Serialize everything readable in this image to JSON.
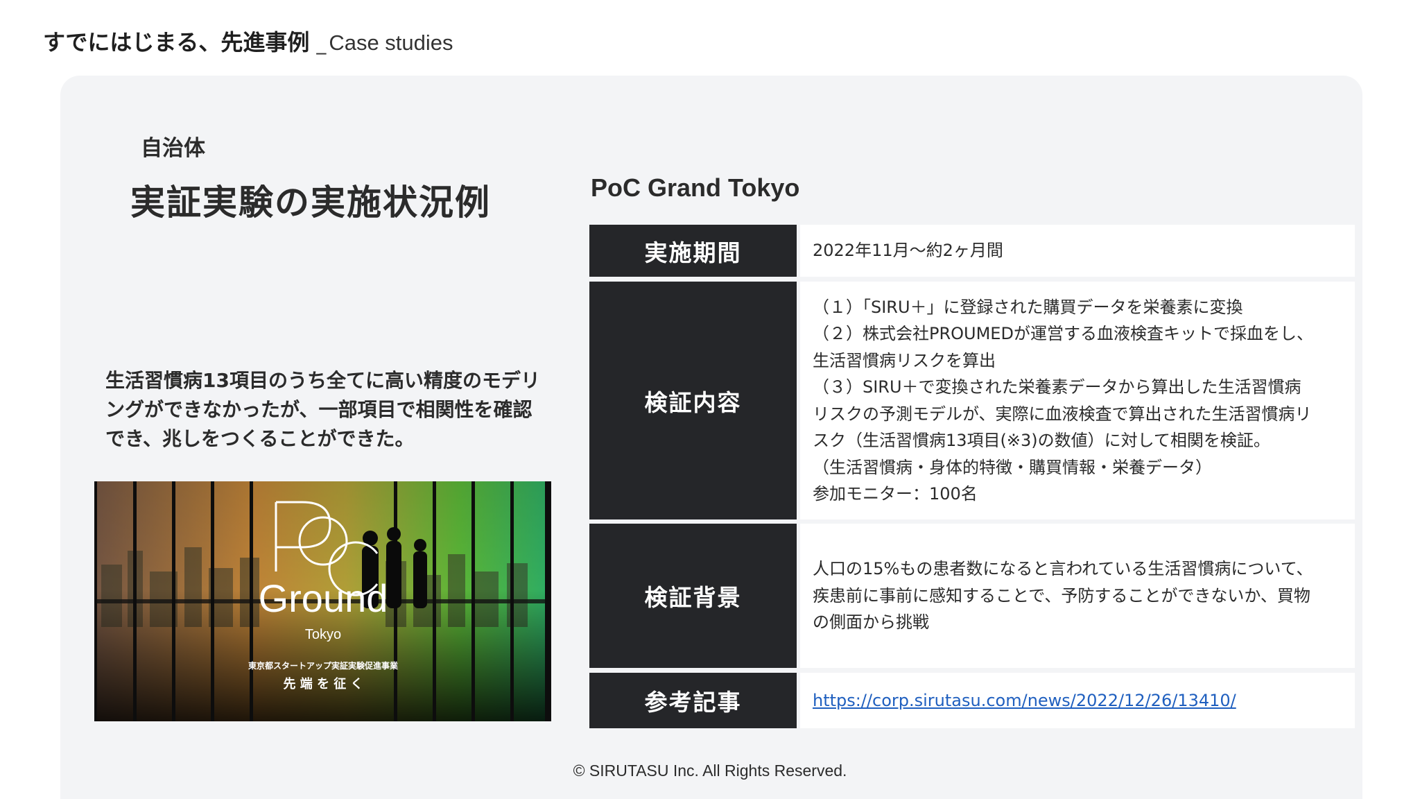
{
  "header": {
    "title": "すでにはじまる、先進事例",
    "separator": "_",
    "subtitle": "Case studies"
  },
  "left": {
    "category": "自治体",
    "title": "実証実験の実施状況例",
    "summary": "生活習慣病13項目のうち全てに高い精度のモデリングができなかったが、一部項目で相関性を確認でき、兆しをつくることができた。",
    "image": {
      "logo_main": "Ground",
      "logo_sub": "Tokyo",
      "caption1": "東京都スタートアップ実証実験促進事業",
      "caption2": "先 端 を 征 く"
    }
  },
  "poc": {
    "title": "PoC Grand Tokyo",
    "rows": [
      {
        "label": "実施期間",
        "lines": [
          "2022年11月〜約2ヶ月間"
        ]
      },
      {
        "label": "検証内容",
        "lines": [
          "（１）「SIRU＋」に登録された購買データを栄養素に変換",
          "（２）株式会社PROUMEDが運営する血液検査キットで採血をし、",
          "生活習慣病リスクを算出",
          "（３）SIRU＋で変換された栄養素データから算出した生活習慣病",
          "リスクの予測モデルが、実際に血液検査で算出された生活習慣病リ",
          "スク（生活習慣病13項目(※3)の数値）に対して相関を検証。",
          "（生活習慣病・身体的特徴・購買情報・栄養データ）",
          "参加モニター：100名"
        ]
      },
      {
        "label": "検証背景",
        "lines": [
          "人口の15%もの患者数になると言われている生活習慣病について、",
          "疾患前に事前に感知することで、予防することができないか、買物",
          "の側面から挑戦"
        ]
      },
      {
        "label": "参考記事",
        "link": "https://corp.sirutasu.com/news/2022/12/26/13410/"
      }
    ]
  },
  "footer": {
    "copyright": "© SIRUTASU Inc.  All Rights Reserved."
  },
  "colors": {
    "label_bg": "#252629",
    "card_bg": "#f3f4f6",
    "link": "#1f5fbf"
  }
}
